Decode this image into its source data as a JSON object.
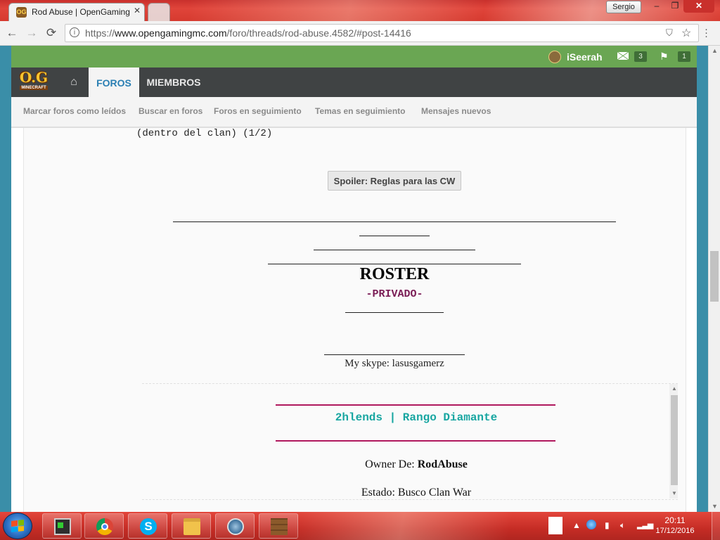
{
  "browser": {
    "tab_title": "Rod Abuse | OpenGaming",
    "tab_close": "✕",
    "user_badge": "Sergio",
    "url_prefix": "https://",
    "url_domain": "www.opengamingmc.com",
    "url_path": "/foro/threads/rod-abuse.4582/#post-14416",
    "back": "←",
    "forward": "→",
    "reload": "⟳",
    "minimize": "–",
    "maximize": "❐",
    "close": "✕"
  },
  "site": {
    "visitor_name": "iSeerah",
    "inbox_count": "3",
    "alerts_count": "1",
    "logo_text": "O.G",
    "logo_sub": "MINECRAFT",
    "home_icon": "⌂",
    "tabs": {
      "forums": "FOROS",
      "members": "MIEMBROS"
    },
    "subnav": [
      "Marcar foros como leídos",
      "Buscar en foros",
      "Foros en seguimiento",
      "Temas en seguimiento",
      "Mensajes nuevos"
    ]
  },
  "post": {
    "clan_line": "(dentro del clan) (1/2)",
    "spoiler_label": "Spoiler: Reglas para las CW",
    "roster_title": "ROSTER",
    "roster_subtitle": "-PRIVADO-",
    "skype": "My skype: lasusgamerz"
  },
  "signature": {
    "title": "2hlends | Rango Diamante",
    "owner_label": "Owner De:",
    "owner_value": "RodAbuse",
    "state": "Estado: Busco Clan War"
  },
  "taskbar": {
    "time": "20:11",
    "date": "17/12/2016",
    "apps": [
      "terminal-app",
      "chrome",
      "skype",
      "explorer",
      "teamspeak",
      "minecraft"
    ]
  },
  "colors": {
    "accent_green": "#6aa653",
    "nav_dark": "#404344",
    "forum_tab_blue": "#2a7fb3",
    "privado_purple": "#7a1c55",
    "sig_teal": "#18a6a1",
    "sig_rule_magenta": "#b0185e",
    "taskbar_red": "#c52c25"
  }
}
